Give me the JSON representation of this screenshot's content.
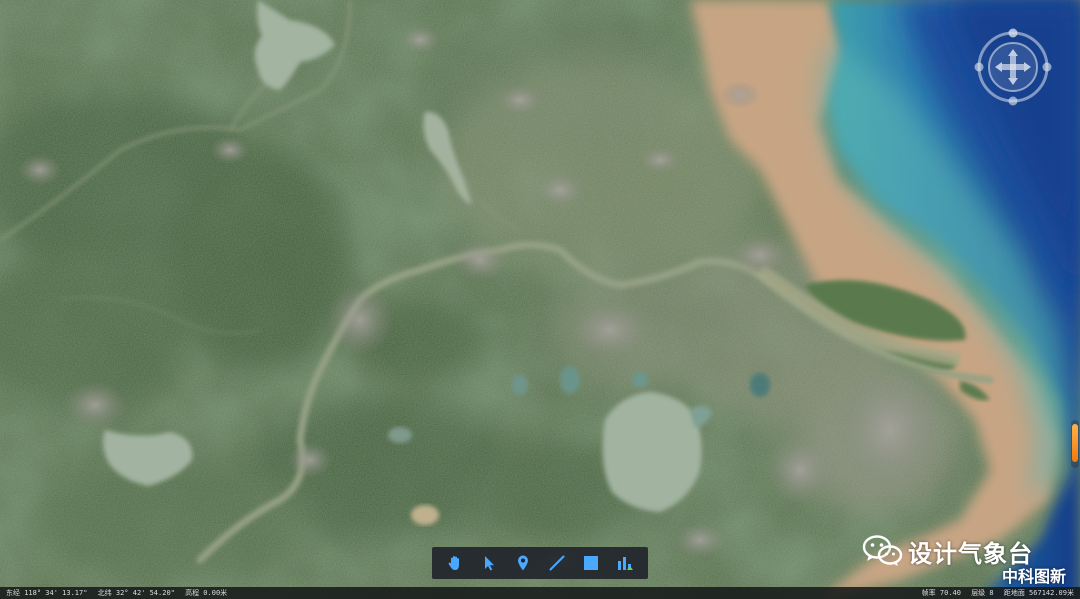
{
  "colors": {
    "land_dark": "#3d5b3b",
    "land_mid": "#56704c",
    "land_light": "#7a8a66",
    "river": "#9aa88c",
    "lake": "#9fb2a0",
    "sediment": "#c9a888",
    "coast_cyan": "#5fb3b8",
    "ocean": "#1f4f9a",
    "ocean_deep": "#123c88",
    "accent_orange": "#f08a1e",
    "toolbar_icon": "#4aa8ff"
  },
  "toolbar": {
    "tools": [
      {
        "name": "pan-tool",
        "icon": "hand-icon"
      },
      {
        "name": "select-tool",
        "icon": "cursor-arrow-icon"
      },
      {
        "name": "placemark-tool",
        "icon": "location-pin-icon"
      },
      {
        "name": "line-tool",
        "icon": "line-icon"
      },
      {
        "name": "polygon-tool",
        "icon": "square-icon"
      },
      {
        "name": "chart-tool",
        "icon": "bar-chart-icon"
      }
    ]
  },
  "status": {
    "longitude": "东经 118° 34' 13.17\"",
    "latitude": "北纬 32° 42' 54.20\"",
    "elevation": "高程 0.00米",
    "framerate": "帧率 70.40",
    "level": "层级 8",
    "camera_distance": "距地面 567142.09米"
  },
  "watermark": {
    "title": "设计气象台",
    "subtitle": "中科图新"
  }
}
